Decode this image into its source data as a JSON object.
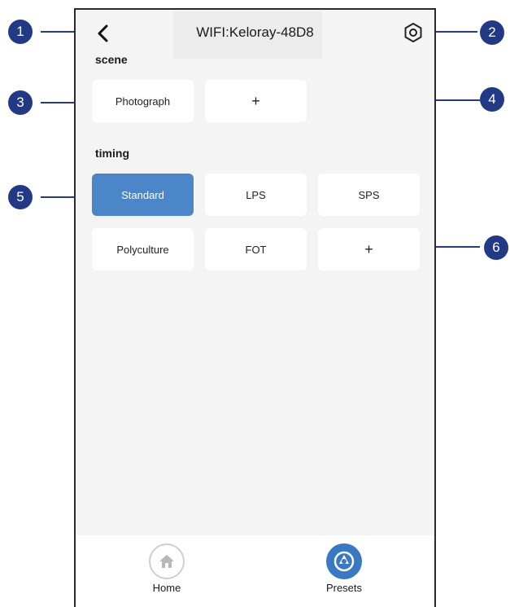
{
  "header": {
    "title": "WIFI:Keloray-48D8"
  },
  "scene": {
    "label": "scene",
    "cards": [
      "Photograph",
      "+"
    ]
  },
  "timing": {
    "label": "timing",
    "cards": [
      "Standard",
      "LPS",
      "SPS",
      "Polyculture",
      "FOT",
      "+"
    ],
    "selected": "Standard"
  },
  "nav": {
    "home_label": "Home",
    "presets_label": "Presets"
  },
  "callouts": [
    "1",
    "2",
    "3",
    "4",
    "5",
    "6"
  ],
  "colors": {
    "accent": "#4a86c8",
    "badge": "#223a86",
    "background": "#f4f4f4"
  },
  "icons": {
    "back": "chevron-left-icon",
    "settings": "hexagon-gear-icon",
    "home": "home-icon",
    "presets": "presets-icon"
  }
}
